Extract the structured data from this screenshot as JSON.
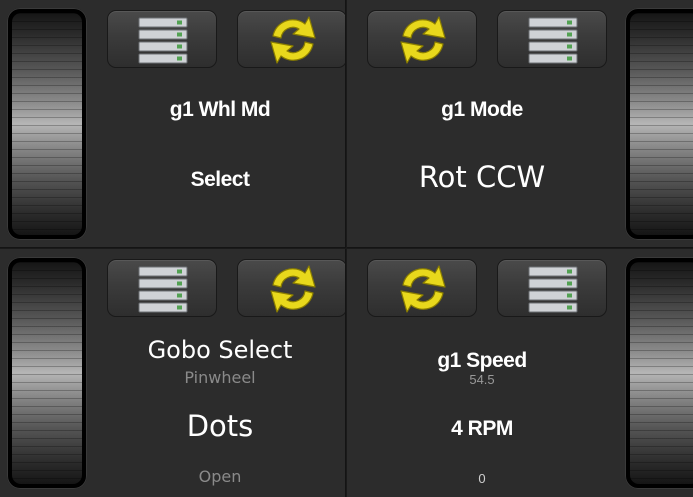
{
  "colors": {
    "background": "#1a1a1a",
    "panel": "#2c2c2c",
    "button": "#3b3b3b",
    "sync_icon": "#e8d81c",
    "text": "#ffffff",
    "muted_text": "#8a8a8a"
  },
  "icons": {
    "stack": "server-stack-icon",
    "sync": "sync-arrows-icon"
  },
  "panels": [
    {
      "title": "g1 Whl Md",
      "value": "Select"
    },
    {
      "title": "g1 Mode",
      "value": "Rot CCW"
    },
    {
      "title": "Gobo Select",
      "subtitle": "Pinwheel",
      "value": "Dots",
      "bottom": "Open"
    },
    {
      "title": "g1 Speed",
      "subtitle": "54.5",
      "value": "4 RPM",
      "bottom": "0"
    }
  ]
}
